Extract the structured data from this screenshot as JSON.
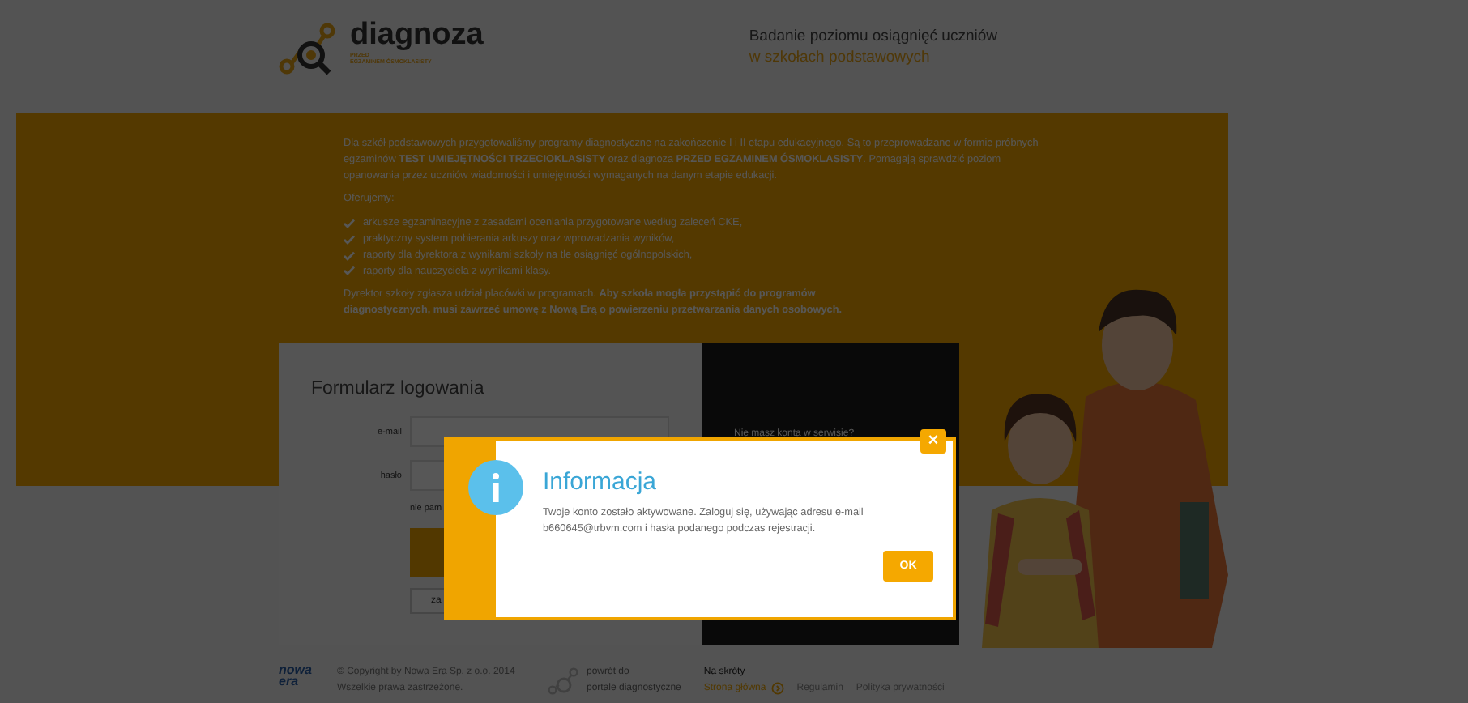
{
  "header": {
    "logo_text": "diagnoza",
    "logo_subtitle_1": "PRZED",
    "logo_subtitle_2": "EGZAMINEM ÓSMOKLASISTY",
    "tagline_1": "Badanie poziomu osiągnięć uczniów",
    "tagline_2": "w szkołach podstawowych"
  },
  "banner": {
    "intro": "Dla szkół podstawowych przygotowaliśmy programy diagnostyczne na zakończenie I i II etapu edukacyjnego. Są to przeprowadzane w formie próbnych egzaminów **TEST UMIEJĘTNOŚCI TRZECIOKLASISTY** oraz diagnoza **PRZED EGZAMINEM ÓSMOKLASISTY**. Pomagają sprawdzić poziom opanowania przez uczniów wiadomości i umiejętności wymaganych na danym etapie edukacji.",
    "offer_heading": "Oferujemy:",
    "offers": [
      "arkusze egzaminacyjne z zasadami oceniania przygotowane według zaleceń CKE,",
      "praktyczny system pobierania arkuszy oraz wprowadzania wyników,",
      "raporty dla dyrektora z wynikami szkoły na tle osiągnięć ogólnopolskich,",
      "raporty dla nauczyciela z wynikami klasy."
    ],
    "closing": "Dyrektor szkoły zgłasza udział placówki w programach. **Aby szkoła mogła przystąpić do programów diagnostycznych, musi zawrzeć umowę z Nową Erą o powierzeniu przetwarzania danych osobowych.**"
  },
  "login": {
    "title": "Formularz logowania",
    "fields": [
      {
        "label": "e-mail"
      },
      {
        "label": "hasło"
      }
    ],
    "forgot_link": "nie pam",
    "second_button": "za"
  },
  "register_panel": {
    "question": "Nie masz konta w serwisie?"
  },
  "dialog": {
    "title": "Informacja",
    "message": "Twoje konto zostało aktywowane. Zaloguj się, używając adresu e-mail b660645@trbvm.com i hasła podanego podczas rejestracji.",
    "ok_button": "OK",
    "close_button": "×"
  },
  "footer": {
    "logo_lines": [
      "nowa",
      "era"
    ],
    "copyright": [
      "© Copyright by Nowa Era Sp. z o.o. 2014",
      "Wszelkie prawa zastrzeżone."
    ],
    "back_link": [
      "powrót do",
      "portale diagnostyczne"
    ],
    "shortcuts_heading": "Na skróty",
    "links": [
      {
        "label": "Strona główna",
        "kind": "home"
      },
      {
        "label": "Regulamin",
        "kind": "plain"
      },
      {
        "label": "Polityka prywatności",
        "kind": "plain"
      }
    ]
  }
}
